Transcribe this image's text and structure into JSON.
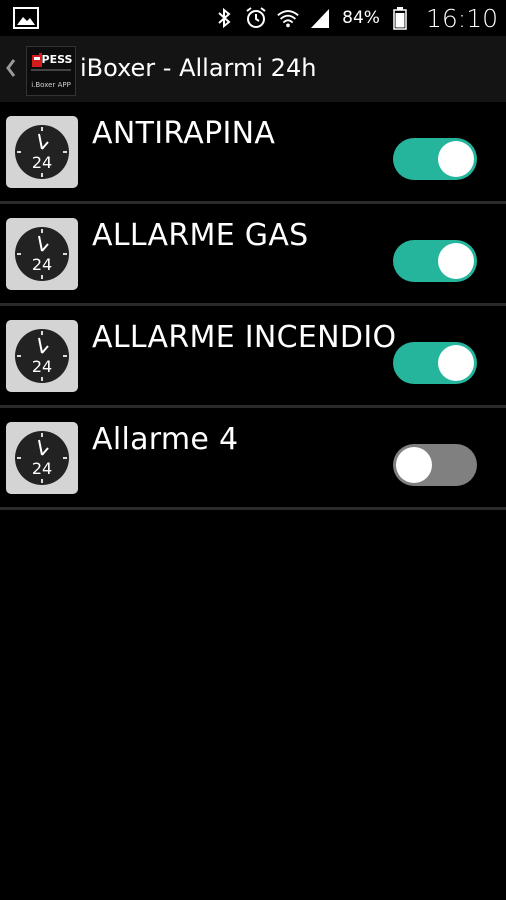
{
  "status_bar": {
    "battery_percent": "84%",
    "time": "16:10",
    "icons": [
      "image-icon",
      "bluetooth-icon",
      "alarm-clock-icon",
      "wifi-icon",
      "signal-icon",
      "battery-icon"
    ]
  },
  "action_bar": {
    "title": "iBoxer - Allarmi 24h",
    "logo_text": "PESS",
    "logo_subtext": "i.Boxer APP"
  },
  "colors": {
    "toggle_on": "#25b59c",
    "toggle_off": "#808080",
    "background": "#000000",
    "action_bar": "#141414"
  },
  "alarms": [
    {
      "label": "ANTIRAPINA",
      "enabled": true,
      "icon": "clock-24h-icon",
      "icon_text": "24"
    },
    {
      "label": "ALLARME GAS",
      "enabled": true,
      "icon": "clock-24h-icon",
      "icon_text": "24"
    },
    {
      "label": "ALLARME INCENDIO",
      "enabled": true,
      "icon": "clock-24h-icon",
      "icon_text": "24"
    },
    {
      "label": "Allarme 4",
      "enabled": false,
      "icon": "clock-24h-icon",
      "icon_text": "24"
    }
  ]
}
